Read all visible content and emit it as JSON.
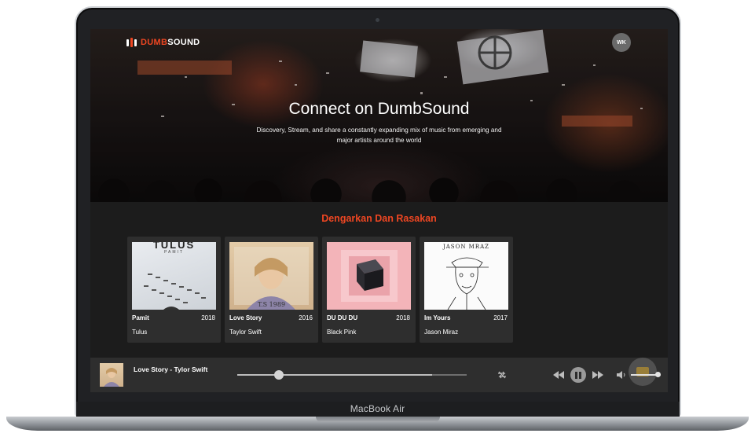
{
  "device": {
    "label": "MacBook Air"
  },
  "header": {
    "brand_prefix": "DUMB",
    "brand_suffix": "SOUND",
    "avatar_initials": "WK"
  },
  "hero": {
    "title": "Connect on DumbSound",
    "subtitle": "Discovery, Stream, and share a constantly expanding mix of music from emerging and major artists around the world"
  },
  "section": {
    "title": "Dengarkan Dan Rasakan"
  },
  "albums": [
    {
      "title": "Pamit",
      "year": "2018",
      "artist": "Tulus",
      "cover_text": "TULUS",
      "cover_sub": "PAMIT"
    },
    {
      "title": "Love Story",
      "year": "2016",
      "artist": "Taylor Swift",
      "cover_text": "T.S      1989"
    },
    {
      "title": "DU DU DU",
      "year": "2018",
      "artist": "Black Pink"
    },
    {
      "title": "Im Yours",
      "year": "2017",
      "artist": "Jason Miraz",
      "cover_text": "JASON MRAZ"
    }
  ],
  "player": {
    "now_playing": "Love Story - Tylor Swift",
    "progress": 0.18,
    "buffered": 0.85,
    "volume": 0.9,
    "icons": [
      "repeat-icon",
      "rewind-icon",
      "pause-icon",
      "fast-forward-icon",
      "volume-icon"
    ]
  },
  "colors": {
    "accent": "#ee4622",
    "background": "#1c1c1c",
    "card": "#2e2e2e"
  }
}
